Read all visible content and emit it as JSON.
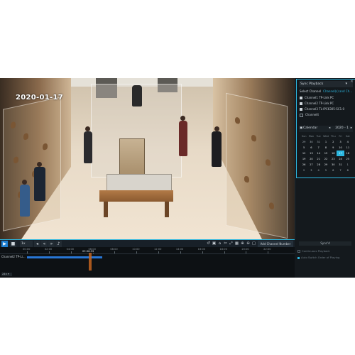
{
  "video": {
    "date_overlay": "2020-01-17"
  },
  "panel": {
    "title": "Sync Playback",
    "select_channel_label": "Select Channel",
    "search_link": "Channel(s) and Ch...",
    "channels": [
      {
        "label": "Channel1 TP-Link PC",
        "checked": true
      },
      {
        "label": "Channel2 TP-Link PC",
        "checked": true
      },
      {
        "label": "Channel3 TL-IPC6305-SC1.0",
        "checked": true
      },
      {
        "label": "Channel4",
        "checked": false
      }
    ],
    "calendar_label": "Calendar",
    "calendar_month": "2020 - 1",
    "weekdays": [
      "Sun",
      "Mon",
      "Tue",
      "Wed",
      "Thu",
      "Fri",
      "Sat"
    ],
    "weeks": [
      [
        "29",
        "30",
        "31",
        "1",
        "2",
        "3",
        "4"
      ],
      [
        "5",
        "6",
        "7",
        "8",
        "9",
        "10",
        "11"
      ],
      [
        "12",
        "13",
        "14",
        "15",
        "16",
        "17",
        "18"
      ],
      [
        "19",
        "20",
        "21",
        "22",
        "23",
        "24",
        "25"
      ],
      [
        "26",
        "27",
        "28",
        "29",
        "30",
        "31",
        "1"
      ],
      [
        "2",
        "3",
        "4",
        "5",
        "6",
        "7",
        "8"
      ]
    ],
    "selected_day": "17"
  },
  "controls": {
    "speed": "1x",
    "add_channel_label": "Add Channel Number"
  },
  "timeline": {
    "ticks": [
      "00:00",
      "02:00",
      "04:00",
      "06:00",
      "08:00",
      "10:00",
      "12:00",
      "14:00",
      "16:00",
      "18:00",
      "20:00",
      "22:00"
    ],
    "cursor_time": "09:36:53",
    "track_label": "Channel2 TP-Li...",
    "zoom": "24h"
  },
  "panel_lower": {
    "sync_label": "Sync'd",
    "options": [
      {
        "label": "Continuous Playback",
        "checked": false
      },
      {
        "label": "Auto Switch Order of Playing",
        "checked": true
      }
    ]
  },
  "colors": {
    "accent": "#2bb7e0",
    "play": "#1f7fd1",
    "recording": "#2877d6",
    "cursor": "#c4641f",
    "selected_day": "#2bb7e0"
  }
}
